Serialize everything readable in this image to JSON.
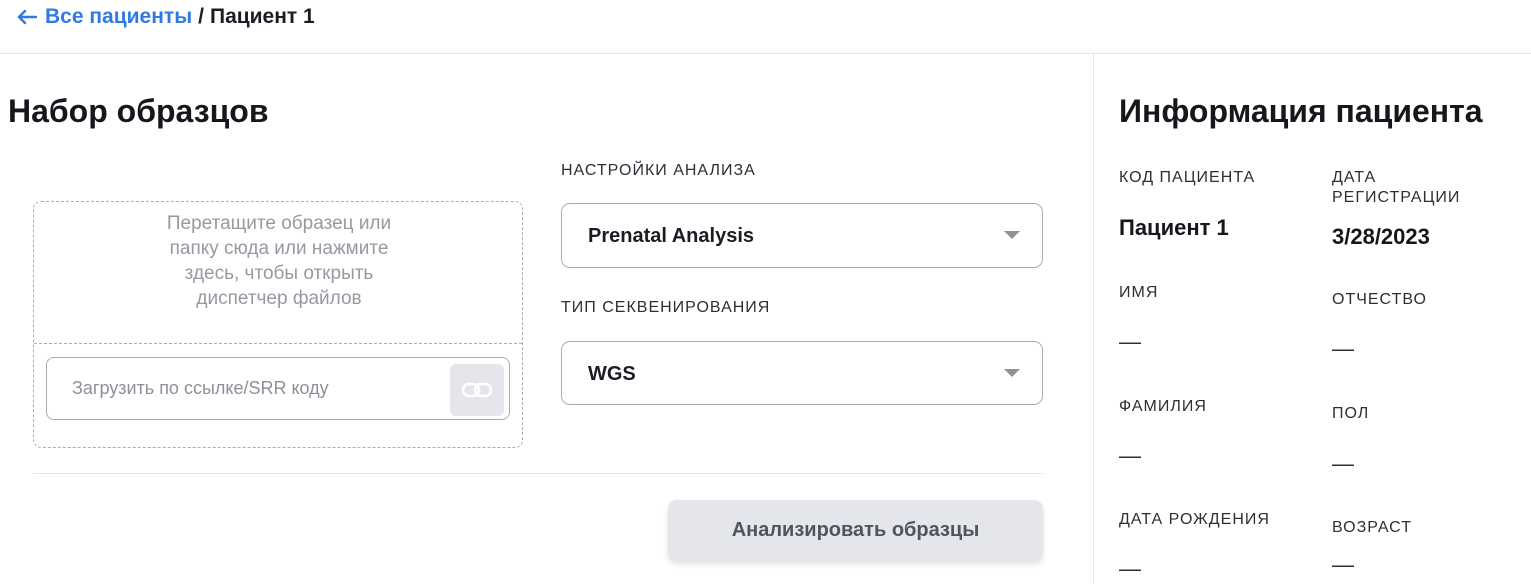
{
  "breadcrumb": {
    "back_label": "Все пациенты",
    "separator": "/",
    "current": "Пациент 1"
  },
  "samples": {
    "title": "Набор образцов",
    "dropzone_text": "Перетащите образец или папку сюда или нажмите здесь, чтобы открыть диспетчер файлов",
    "url_placeholder": "Загрузить по ссылке/SRR коду",
    "analysis_settings_label": "НАСТРОЙКИ АНАЛИЗА",
    "analysis_selected": "Prenatal Analysis",
    "sequencing_type_label": "ТИП СЕКВЕНИРОВАНИЯ",
    "sequencing_selected": "WGS",
    "analyze_button": "Анализировать образцы"
  },
  "patient": {
    "title": "Информация пациента",
    "code_label": "КОД ПАЦИЕНТА",
    "code_value": "Пациент 1",
    "reg_date_label": "ДАТА РЕГИСТРАЦИИ",
    "reg_date_value": "3/28/2023",
    "first_name_label": "ИМЯ",
    "first_name_value": "—",
    "patronymic_label": "ОТЧЕСТВО",
    "patronymic_value": "—",
    "last_name_label": "ФАМИЛИЯ",
    "last_name_value": "—",
    "sex_label": "ПОЛ",
    "sex_value": "—",
    "birth_date_label": "ДАТА РОЖДЕНИЯ",
    "birth_date_value": "—",
    "age_label": "ВОЗРАСТ",
    "age_value": "—"
  },
  "colors": {
    "link": "#2f7ae5",
    "button_bg": "#e4e6eb",
    "border": "#a9adb5"
  },
  "icons": {
    "back": "arrow-left-icon",
    "link": "link-icon",
    "caret": "chevron-down-icon"
  }
}
